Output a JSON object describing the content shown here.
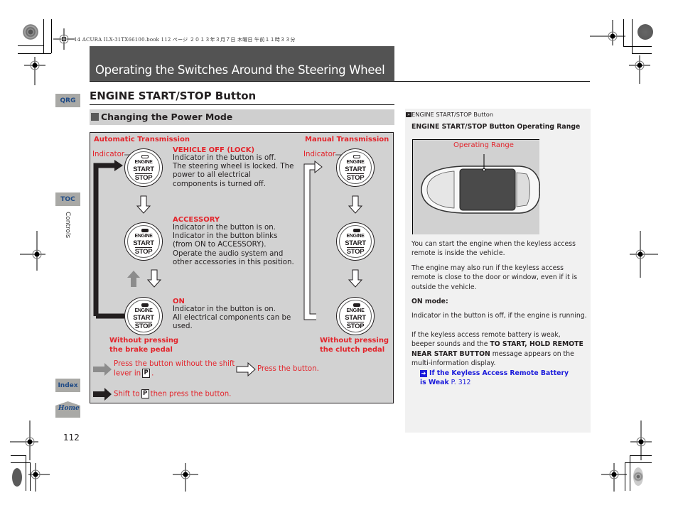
{
  "file_header": "14 ACURA ILX-31TX66100.book  112 ページ  ２０１３年３月７日  木曜日  午前１１時３３分",
  "chapter_title": "Operating the Switches Around the Steering Wheel",
  "side_nav": {
    "qrg": "QRG",
    "toc": "TOC",
    "chapter": "Controls",
    "index": "Index",
    "home": "Home"
  },
  "page_number": "112",
  "section_title": "ENGINE START/STOP Button",
  "subsection_title": "Changing the Power Mode",
  "diagram": {
    "automatic_label": "Automatic Transmission",
    "manual_label": "Manual Transmission",
    "indicator_label": "Indicator",
    "button": {
      "line1": "ENGINE",
      "line2": "START",
      "line3": "STOP"
    },
    "modes": [
      {
        "title": "VEHICLE OFF (LOCK)",
        "lines": [
          "Indicator in the button is off.",
          "The steering wheel is locked. The",
          "power to all electrical",
          "components is turned off."
        ],
        "indicator_on": false
      },
      {
        "title": "ACCESSORY",
        "lines": [
          "Indicator in the button is on.",
          "Indicator in the button blinks",
          "(from ON to ACCESSORY).",
          "Operate the audio system and",
          "other accessories in this position."
        ],
        "indicator_on": true
      },
      {
        "title": "ON",
        "lines": [
          "Indicator in the button is on.",
          "All electrical components can be",
          "used."
        ],
        "indicator_on": true
      }
    ],
    "auto_note": [
      "Without pressing",
      "the brake pedal"
    ],
    "manual_note": [
      "Without pressing",
      "the clutch pedal"
    ],
    "legend": {
      "gray_arrow_line1": "Press the button without the shift",
      "gray_arrow_line2_prefix": "lever in",
      "gray_arrow_line2_suffix": ".",
      "white_arrow": "Press the button.",
      "black_arrow_prefix": "Shift to",
      "black_arrow_suffix": "then press the button.",
      "gear": "P"
    }
  },
  "notes": {
    "ref_label": "ENGINE START/STOP Button",
    "heading": "ENGINE START/STOP Button Operating Range",
    "image_label": "Operating Range",
    "para1": "You can start the engine when the keyless access remote is inside the vehicle.",
    "para2": "The engine may also run if the keyless access remote is close to the door or window, even if it is outside the vehicle.",
    "on_mode_title": "ON mode:",
    "on_mode_text": "Indicator in the button is off, if the engine is running.",
    "para3_a": "If the keyless access remote battery is weak, beeper sounds and the ",
    "para3_bold": "TO START, HOLD REMOTE NEAR START BUTTON",
    "para3_b": " message appears on the multi-information display.",
    "link_text": "If the Keyless Access Remote Battery is Weak",
    "link_page": "P. 312"
  },
  "colors": {
    "accent_red": "#e3242b",
    "link_blue": "#1a1adb",
    "nav_blue": "#1e4a86",
    "title_bar": "#535353"
  }
}
